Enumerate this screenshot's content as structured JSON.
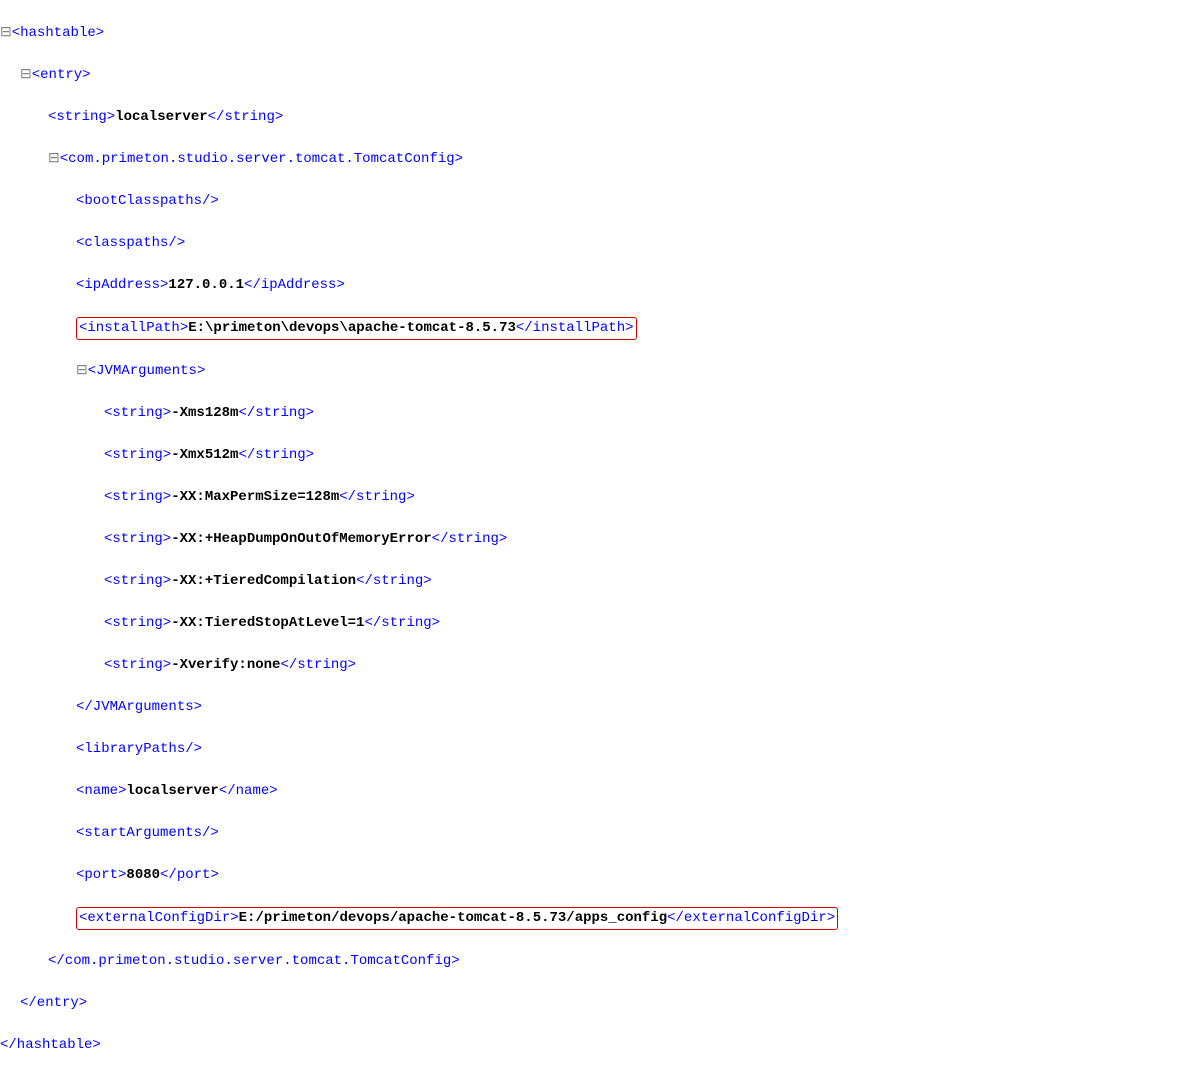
{
  "xml": {
    "hashtable_open": "<hashtable>",
    "entry_open": "<entry>",
    "string1": {
      "open": "<string>",
      "val": "localserver",
      "close": "</string>"
    },
    "config_open": "<com.primeton.studio.server.tomcat.TomcatConfig>",
    "bootClasspaths": "<bootClasspaths/>",
    "classpaths": "<classpaths/>",
    "ip": {
      "open": "<ipAddress>",
      "val": "127.0.0.1",
      "close": "</ipAddress>"
    },
    "installPath": {
      "open": "<installPath>",
      "val": "E:\\primeton\\devops\\apache-tomcat-8.5.73",
      "close": "</installPath>"
    },
    "jvm_open": "<JVMArguments>",
    "jvm": [
      {
        "open": "<string>",
        "val": "-Xms128m",
        "close": "</string>"
      },
      {
        "open": "<string>",
        "val": "-Xmx512m",
        "close": "</string>"
      },
      {
        "open": "<string>",
        "val": "-XX:MaxPermSize=128m",
        "close": "</string>"
      },
      {
        "open": "<string>",
        "val": "-XX:+HeapDumpOnOutOfMemoryError",
        "close": "</string>"
      },
      {
        "open": "<string>",
        "val": "-XX:+TieredCompilation",
        "close": "</string>"
      },
      {
        "open": "<string>",
        "val": "-XX:TieredStopAtLevel=1",
        "close": "</string>"
      },
      {
        "open": "<string>",
        "val": "-Xverify:none",
        "close": "</string>"
      }
    ],
    "jvm_close": "</JVMArguments>",
    "libraryPaths": "<libraryPaths/>",
    "name": {
      "open": "<name>",
      "val": "localserver",
      "close": "</name>"
    },
    "startArguments": "<startArguments/>",
    "port": {
      "open": "<port>",
      "val": "8080",
      "close": "</port>"
    },
    "externalConfigDir": {
      "open": "<externalConfigDir>",
      "val": "E:/primeton/devops/apache-tomcat-8.5.73/apps_config",
      "close": "</externalConfigDir>"
    },
    "config_close": "</com.primeton.studio.server.tomcat.TomcatConfig>",
    "entry_close": "</entry>",
    "hashtable_close": "</hashtable>"
  },
  "fold": "⊟"
}
